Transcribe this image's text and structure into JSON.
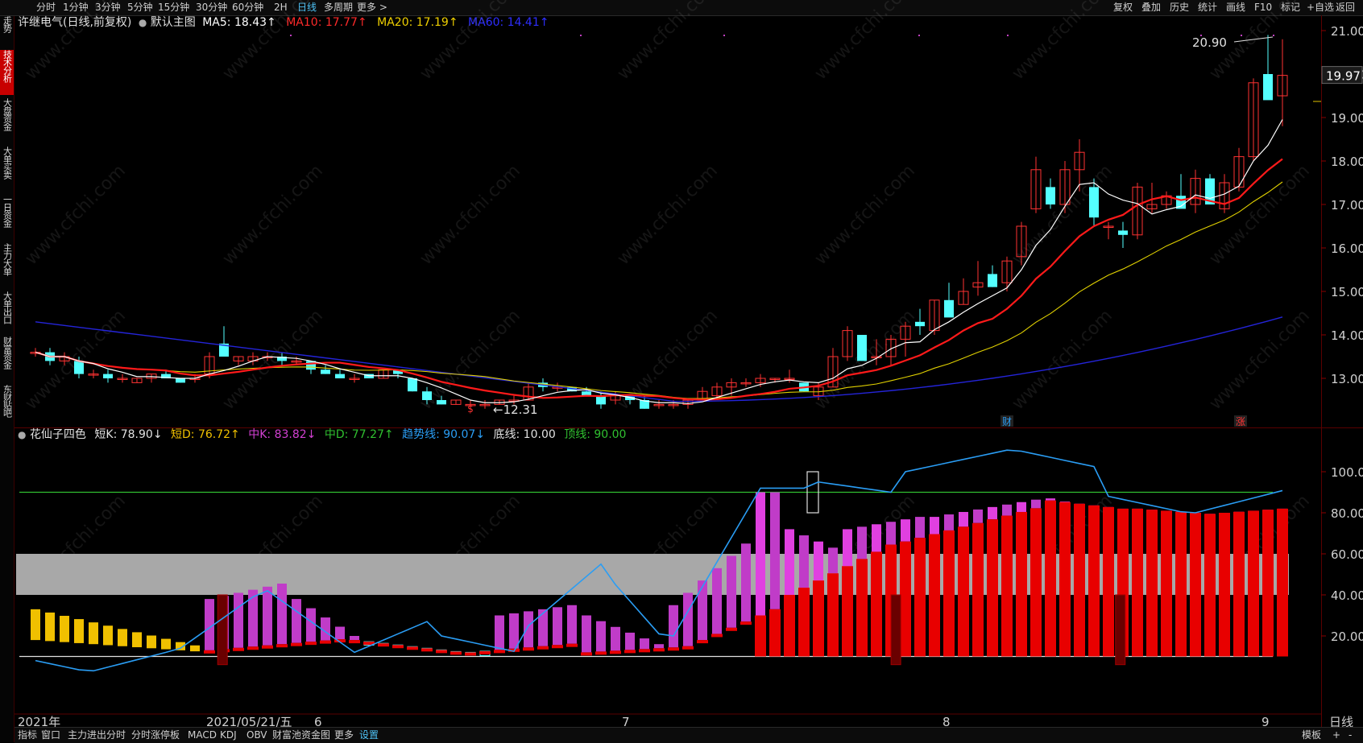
{
  "toolbar": {
    "left_items": [
      "分时",
      "1分钟",
      "3分钟",
      "5分钟",
      "15分钟",
      "30分钟",
      "60分钟",
      "2H",
      "日线",
      "多周期",
      "更多 >"
    ],
    "active_item": "日线",
    "right_items": [
      "复权",
      "叠加",
      "历史",
      "统计",
      "画线",
      "F10",
      "标记",
      "+自选",
      "返回"
    ]
  },
  "left_tabs": [
    {
      "label": "分时走势",
      "active": false
    },
    {
      "label": "技术分析",
      "active": true
    },
    {
      "label": "大盘资金",
      "active": false
    },
    {
      "label": "大单买卖",
      "active": false
    },
    {
      "label": "一日资金",
      "active": false
    },
    {
      "label": "主力大单",
      "active": false
    },
    {
      "label": "大单出口",
      "active": false
    },
    {
      "label": "财富资金",
      "active": false
    },
    {
      "label": "东财贴吧",
      "active": false
    }
  ],
  "main_header": {
    "stock": "许继电气(日线,前复权)",
    "template": "默认主图",
    "ma5": "MA5: 18.43↑",
    "ma10": "MA10: 17.77↑",
    "ma20": "MA20: 17.19↑",
    "ma60": "MA60: 14.41↑",
    "colors": {
      "ma5": "#ffffff",
      "ma10": "#ff2a2a",
      "ma20": "#f0d000",
      "ma60": "#2e2eff"
    }
  },
  "indicator_header": {
    "name": "花仙子四色",
    "short_k": "短K: 78.90↓",
    "short_d": "短D: 76.72↑",
    "mid_k": "中K: 83.82↓",
    "mid_d": "中D: 77.27↑",
    "trend": "趋势线: 90.07↓",
    "bottom": "底线: 10.00",
    "top": "顶线: 90.00",
    "colors": {
      "short_k": "#e0e0e0",
      "short_d": "#f0c000",
      "mid_k": "#d040d0",
      "mid_d": "#30c030",
      "trend": "#2a9df4",
      "bottom": "#e0e0e0",
      "top": "#30c030"
    }
  },
  "price_axis": {
    "labels": [
      "21.00",
      "20.00",
      "19.00",
      "18.00",
      "17.00",
      "16.00",
      "15.00",
      "14.00",
      "13.00"
    ],
    "current": "19.97",
    "high_label": "20.90",
    "low_label": "←12.31",
    "event_marks": [
      "$",
      "财",
      "涨"
    ]
  },
  "indicator_axis": {
    "labels": [
      "100.0",
      "80.00",
      "60.00",
      "40.00",
      "20.00"
    ]
  },
  "date_axis": {
    "labels": [
      "2021年",
      "2021/05/21/五",
      "6",
      "7",
      "8",
      "9"
    ],
    "right": "日线"
  },
  "watermark": "www.cfchi.com",
  "bottom_tabs": {
    "items": [
      "指标",
      "窗口",
      "主力进出分时",
      "分时涨停板",
      "MACD",
      "KDJ",
      "OBV",
      "财富池资金图",
      "更多",
      "设置"
    ],
    "active": "设置",
    "right_items": [
      "模板",
      "+",
      "-"
    ]
  },
  "chart_data": {
    "type": "candlestick",
    "price_range": [
      12.2,
      21.2
    ],
    "candles": [
      {
        "o": 13.6,
        "h": 13.7,
        "l": 13.5,
        "c": 13.6
      },
      {
        "o": 13.6,
        "h": 13.7,
        "l": 13.3,
        "c": 13.4
      },
      {
        "o": 13.4,
        "h": 13.6,
        "l": 13.3,
        "c": 13.5
      },
      {
        "o": 13.4,
        "h": 13.5,
        "l": 13.0,
        "c": 13.1
      },
      {
        "o": 13.1,
        "h": 13.2,
        "l": 13.0,
        "c": 13.1
      },
      {
        "o": 13.1,
        "h": 13.2,
        "l": 12.9,
        "c": 13.0
      },
      {
        "o": 13.0,
        "h": 13.1,
        "l": 12.9,
        "c": 13.0
      },
      {
        "o": 12.9,
        "h": 13.0,
        "l": 12.9,
        "c": 13.0
      },
      {
        "o": 13.0,
        "h": 13.1,
        "l": 12.9,
        "c": 13.1
      },
      {
        "o": 13.1,
        "h": 13.2,
        "l": 13.0,
        "c": 13.0
      },
      {
        "o": 13.0,
        "h": 13.0,
        "l": 12.9,
        "c": 12.9
      },
      {
        "o": 13.0,
        "h": 13.1,
        "l": 12.9,
        "c": 13.0
      },
      {
        "o": 13.1,
        "h": 13.6,
        "l": 13.0,
        "c": 13.5
      },
      {
        "o": 13.8,
        "h": 14.2,
        "l": 13.5,
        "c": 13.5
      },
      {
        "o": 13.4,
        "h": 13.5,
        "l": 13.3,
        "c": 13.5
      },
      {
        "o": 13.4,
        "h": 13.6,
        "l": 13.3,
        "c": 13.5
      },
      {
        "o": 13.5,
        "h": 13.6,
        "l": 13.4,
        "c": 13.5
      },
      {
        "o": 13.5,
        "h": 13.6,
        "l": 13.3,
        "c": 13.4
      },
      {
        "o": 13.4,
        "h": 13.5,
        "l": 13.3,
        "c": 13.4
      },
      {
        "o": 13.4,
        "h": 13.4,
        "l": 13.1,
        "c": 13.2
      },
      {
        "o": 13.2,
        "h": 13.3,
        "l": 13.1,
        "c": 13.1
      },
      {
        "o": 13.1,
        "h": 13.2,
        "l": 13.0,
        "c": 13.0
      },
      {
        "o": 13.0,
        "h": 13.1,
        "l": 12.9,
        "c": 13.0
      },
      {
        "o": 13.1,
        "h": 13.1,
        "l": 13.0,
        "c": 13.0
      },
      {
        "o": 13.0,
        "h": 13.2,
        "l": 13.0,
        "c": 13.2
      },
      {
        "o": 13.2,
        "h": 13.2,
        "l": 13.0,
        "c": 13.1
      },
      {
        "o": 13.0,
        "h": 13.0,
        "l": 12.7,
        "c": 12.7
      },
      {
        "o": 12.7,
        "h": 12.8,
        "l": 12.4,
        "c": 12.5
      },
      {
        "o": 12.5,
        "h": 12.6,
        "l": 12.4,
        "c": 12.4
      },
      {
        "o": 12.4,
        "h": 12.5,
        "l": 12.4,
        "c": 12.5
      },
      {
        "o": 12.4,
        "h": 12.5,
        "l": 12.3,
        "c": 12.4
      },
      {
        "o": 12.4,
        "h": 12.5,
        "l": 12.3,
        "c": 12.4
      },
      {
        "o": 12.4,
        "h": 12.5,
        "l": 12.4,
        "c": 12.5
      },
      {
        "o": 12.5,
        "h": 12.6,
        "l": 12.4,
        "c": 12.5
      },
      {
        "o": 12.5,
        "h": 12.9,
        "l": 12.5,
        "c": 12.8
      },
      {
        "o": 12.9,
        "h": 13.0,
        "l": 12.7,
        "c": 12.8
      },
      {
        "o": 12.8,
        "h": 12.9,
        "l": 12.7,
        "c": 12.8
      },
      {
        "o": 12.8,
        "h": 12.8,
        "l": 12.7,
        "c": 12.7
      },
      {
        "o": 12.7,
        "h": 12.8,
        "l": 12.6,
        "c": 12.6
      },
      {
        "o": 12.6,
        "h": 12.7,
        "l": 12.3,
        "c": 12.4
      },
      {
        "o": 12.5,
        "h": 12.7,
        "l": 12.4,
        "c": 12.6
      },
      {
        "o": 12.6,
        "h": 12.6,
        "l": 12.4,
        "c": 12.5
      },
      {
        "o": 12.5,
        "h": 12.6,
        "l": 12.3,
        "c": 12.3
      },
      {
        "o": 12.4,
        "h": 12.5,
        "l": 12.3,
        "c": 12.4
      },
      {
        "o": 12.4,
        "h": 12.5,
        "l": 12.3,
        "c": 12.4
      },
      {
        "o": 12.4,
        "h": 12.5,
        "l": 12.3,
        "c": 12.5
      },
      {
        "o": 12.5,
        "h": 12.8,
        "l": 12.5,
        "c": 12.7
      },
      {
        "o": 12.6,
        "h": 12.9,
        "l": 12.5,
        "c": 12.8
      },
      {
        "o": 12.8,
        "h": 13.0,
        "l": 12.6,
        "c": 12.9
      },
      {
        "o": 12.9,
        "h": 13.0,
        "l": 12.8,
        "c": 12.9
      },
      {
        "o": 12.9,
        "h": 13.1,
        "l": 12.8,
        "c": 13.0
      },
      {
        "o": 13.0,
        "h": 13.0,
        "l": 12.9,
        "c": 13.0
      },
      {
        "o": 13.0,
        "h": 13.2,
        "l": 12.9,
        "c": 13.0
      },
      {
        "o": 12.9,
        "h": 12.9,
        "l": 12.7,
        "c": 12.7
      },
      {
        "o": 12.6,
        "h": 12.9,
        "l": 12.5,
        "c": 12.8
      },
      {
        "o": 12.8,
        "h": 13.7,
        "l": 12.8,
        "c": 13.5
      },
      {
        "o": 13.5,
        "h": 14.2,
        "l": 13.4,
        "c": 14.1
      },
      {
        "o": 14.0,
        "h": 14.0,
        "l": 13.4,
        "c": 13.4
      },
      {
        "o": 13.5,
        "h": 13.9,
        "l": 13.3,
        "c": 13.5
      },
      {
        "o": 13.5,
        "h": 14.0,
        "l": 13.3,
        "c": 13.9
      },
      {
        "o": 13.9,
        "h": 14.3,
        "l": 13.5,
        "c": 14.2
      },
      {
        "o": 14.3,
        "h": 14.6,
        "l": 14.0,
        "c": 14.2
      },
      {
        "o": 14.1,
        "h": 14.8,
        "l": 14.0,
        "c": 14.8
      },
      {
        "o": 14.8,
        "h": 15.2,
        "l": 14.5,
        "c": 14.4
      },
      {
        "o": 14.7,
        "h": 15.3,
        "l": 14.7,
        "c": 15.0
      },
      {
        "o": 15.1,
        "h": 15.7,
        "l": 14.9,
        "c": 15.2
      },
      {
        "o": 15.4,
        "h": 15.6,
        "l": 15.1,
        "c": 15.1
      },
      {
        "o": 15.2,
        "h": 15.8,
        "l": 15.0,
        "c": 15.7
      },
      {
        "o": 15.8,
        "h": 16.6,
        "l": 15.6,
        "c": 16.5
      },
      {
        "o": 16.9,
        "h": 18.1,
        "l": 16.8,
        "c": 17.8
      },
      {
        "o": 17.4,
        "h": 17.6,
        "l": 16.9,
        "c": 17.0
      },
      {
        "o": 17.0,
        "h": 18.0,
        "l": 16.8,
        "c": 17.8
      },
      {
        "o": 17.8,
        "h": 18.5,
        "l": 17.3,
        "c": 18.2
      },
      {
        "o": 17.4,
        "h": 17.6,
        "l": 16.5,
        "c": 16.7
      },
      {
        "o": 16.5,
        "h": 16.6,
        "l": 16.2,
        "c": 16.5
      },
      {
        "o": 16.4,
        "h": 16.6,
        "l": 16.0,
        "c": 16.3
      },
      {
        "o": 16.3,
        "h": 17.5,
        "l": 16.2,
        "c": 17.4
      },
      {
        "o": 16.9,
        "h": 17.5,
        "l": 16.8,
        "c": 17.0
      },
      {
        "o": 17.0,
        "h": 17.3,
        "l": 16.9,
        "c": 17.2
      },
      {
        "o": 17.2,
        "h": 17.7,
        "l": 17.0,
        "c": 16.9
      },
      {
        "o": 17.0,
        "h": 17.8,
        "l": 16.8,
        "c": 17.6
      },
      {
        "o": 17.6,
        "h": 17.7,
        "l": 17.0,
        "c": 17.0
      },
      {
        "o": 16.9,
        "h": 17.7,
        "l": 16.8,
        "c": 17.5
      },
      {
        "o": 17.4,
        "h": 18.3,
        "l": 17.3,
        "c": 18.1
      },
      {
        "o": 18.1,
        "h": 19.9,
        "l": 18.0,
        "c": 19.8
      },
      {
        "o": 20.0,
        "h": 20.9,
        "l": 19.5,
        "c": 19.4
      },
      {
        "o": 19.5,
        "h": 20.8,
        "l": 18.8,
        "c": 19.97
      }
    ]
  }
}
